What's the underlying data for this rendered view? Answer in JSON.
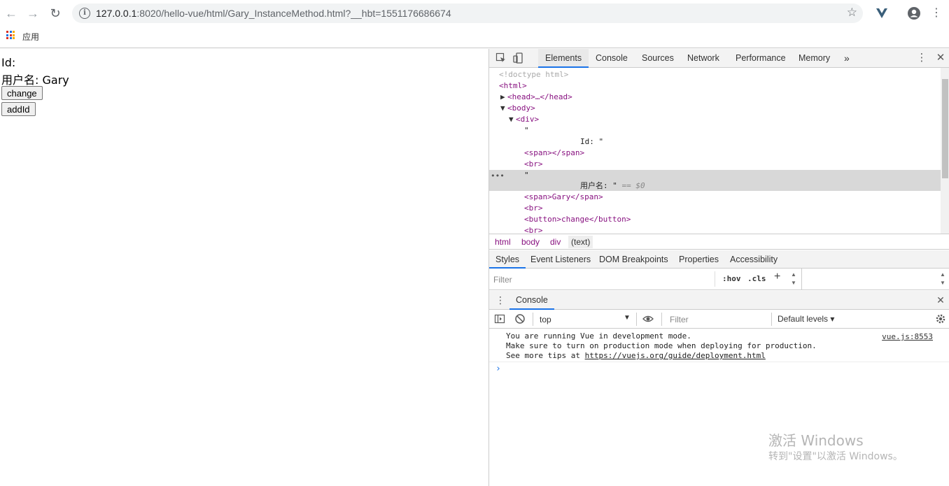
{
  "browser": {
    "url_host": "127.0.0.1",
    "url_rest": ":8020/hello-vue/html/Gary_InstanceMethod.html?__hbt=1551176686674",
    "bookmark_apps": "应用"
  },
  "page": {
    "id_label": "Id:",
    "username_label": "用户名:",
    "username_value": "Gary",
    "change_button": "change",
    "addid_button": "addId"
  },
  "devtools": {
    "tabs": [
      "Elements",
      "Console",
      "Sources",
      "Network",
      "Performance",
      "Memory"
    ],
    "more": "»",
    "dom": {
      "doctype": "<!doctype html>",
      "html_open": "<html>",
      "head": "<head>…</head>",
      "body_open": "<body>",
      "div_open": "<div>",
      "quote1": "\"",
      "id_text": "Id: \"",
      "span_empty": "<span></span>",
      "br1": "<br>",
      "quote2": "\"",
      "username_text": "用户名: \"",
      "eq0": "== $0",
      "span_gary": "<span>Gary</span>",
      "br2": "<br>",
      "button_change": "<button>change</button>",
      "br3": "<br>"
    },
    "breadcrumbs": [
      "html",
      "body",
      "div",
      "(text)"
    ],
    "subtabs": [
      "Styles",
      "Event Listeners",
      "DOM Breakpoints",
      "Properties",
      "Accessibility"
    ],
    "styles_filter_placeholder": "Filter",
    "hov": ":hov",
    "cls": ".cls",
    "drawer_tab": "Console",
    "console_context": "top",
    "console_filter_placeholder": "Filter",
    "default_levels": "Default levels ▾",
    "console_line1": "You are running Vue in development mode.",
    "console_line2": "Make sure to turn on production mode when deploying for production.",
    "console_line3_prefix": "See more tips at ",
    "console_line3_link": "https://vuejs.org/guide/deployment.html",
    "console_source": "vue.js:8553"
  },
  "watermark": {
    "line1": "激活 Windows",
    "line2": "转到\"设置\"以激活 Windows。"
  }
}
